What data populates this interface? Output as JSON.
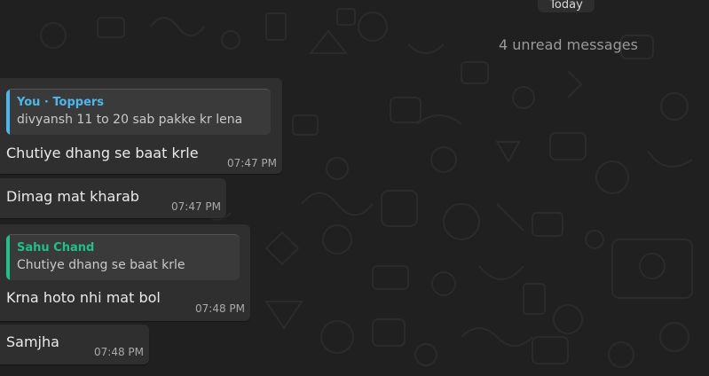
{
  "date_divider": "Today",
  "unread_label": "4 unread messages",
  "colors": {
    "background": "#202020",
    "bubble": "#2f2f2f",
    "quote_you": "#4fb6ec",
    "quote_other": "#1ec08c"
  },
  "messages": [
    {
      "quote": {
        "author": "You · Toppers",
        "text": "divyansh 11 to 20 sab pakke kr lena"
      },
      "text": "Chutiye dhang se baat krle",
      "time": "07:47 PM"
    },
    {
      "text": "Dimag mat kharab",
      "time": "07:47 PM"
    },
    {
      "quote": {
        "author": "Sahu Chand",
        "text": "Chutiye dhang se baat krle"
      },
      "text": "Krna hoto nhi mat bol",
      "time": "07:48 PM"
    },
    {
      "text": "Samjha",
      "time": "07:48 PM"
    }
  ]
}
